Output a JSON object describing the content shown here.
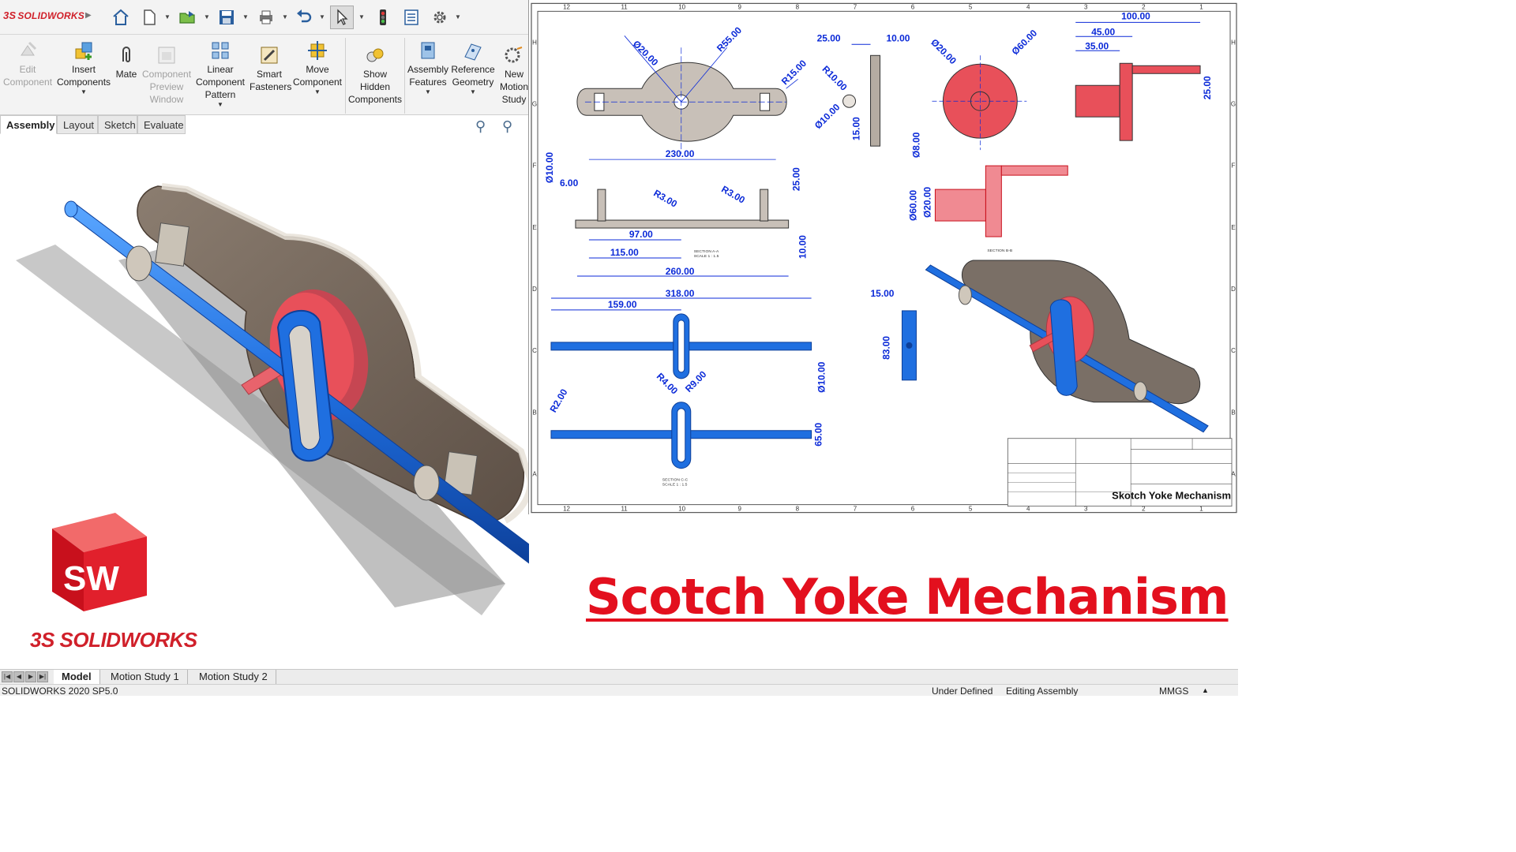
{
  "app": {
    "brand": "SOLIDWORKS",
    "brand_prefix": "3S"
  },
  "ribbon": {
    "buttons": [
      {
        "label": "Edit Component",
        "lines": [
          "Edit",
          "Component"
        ],
        "enabled": false
      },
      {
        "label": "Insert Components",
        "lines": [
          "Insert",
          "Components"
        ],
        "enabled": true,
        "dropdown": true
      },
      {
        "label": "Mate",
        "lines": [
          "Mate"
        ],
        "enabled": true
      },
      {
        "label": "Component Preview Window",
        "lines": [
          "Component",
          "Preview",
          "Window"
        ],
        "enabled": false
      },
      {
        "label": "Linear Component Pattern",
        "lines": [
          "Linear",
          "Component",
          "Pattern"
        ],
        "enabled": true,
        "dropdown": true
      },
      {
        "label": "Smart Fasteners",
        "lines": [
          "Smart",
          "Fasteners"
        ],
        "enabled": true
      },
      {
        "label": "Move Component",
        "lines": [
          "Move",
          "Component"
        ],
        "enabled": true,
        "dropdown": true
      },
      {
        "label": "Show Hidden Components",
        "lines": [
          "Show",
          "Hidden",
          "Components"
        ],
        "enabled": true
      },
      {
        "label": "Assembly Features",
        "lines": [
          "Assembly",
          "Features"
        ],
        "enabled": true,
        "dropdown": true
      },
      {
        "label": "Reference Geometry",
        "lines": [
          "Reference",
          "Geometry"
        ],
        "enabled": true,
        "dropdown": true
      },
      {
        "label": "New Motion Study",
        "lines": [
          "New",
          "Motion",
          "Study"
        ],
        "enabled": true
      }
    ]
  },
  "command_tabs": [
    "Assembly",
    "Layout",
    "Sketch",
    "Evaluate"
  ],
  "active_command_tab": "Assembly",
  "bottom_tabs": [
    "Model",
    "Motion Study 1",
    "Motion Study 2"
  ],
  "active_bottom_tab": "Model",
  "status_bar": {
    "version": "SOLIDWORKS 2020 SP5.0",
    "state": "Under Defined",
    "mode": "Editing Assembly",
    "units": "MMGS"
  },
  "title_overlay": "Scotch Yoke Mechanism",
  "logo_caption": "SOLIDWORKS",
  "logo_letters": "SW",
  "drawing": {
    "title_block_name": "Skotch Yoke Mechanism",
    "zone_columns": [
      "12",
      "11",
      "10",
      "9",
      "8",
      "7",
      "6",
      "5",
      "4",
      "3",
      "2",
      "1"
    ],
    "zone_rows": [
      "H",
      "G",
      "F",
      "E",
      "D",
      "C",
      "B",
      "A"
    ],
    "dimensions": {
      "base_top": [
        "Ø20.00",
        "R55.00",
        "R15.00",
        "230.00"
      ],
      "base_side": [
        "25.00",
        "10.00",
        "R10.00",
        "Ø10.00",
        "15.00"
      ],
      "disc_front": [
        "Ø20.00",
        "Ø60.00"
      ],
      "disc_side": [
        "100.00",
        "45.00",
        "35.00",
        "25.00"
      ],
      "section_aa": [
        "Ø10.00",
        "6.00",
        "R3.00",
        "R3.00",
        "25.00",
        "97.00",
        "115.00",
        "260.00",
        "10.00"
      ],
      "section_bb": [
        "Ø8.00",
        "Ø60.00",
        "Ø20.00"
      ],
      "yoke_front": [
        "318.00",
        "159.00",
        "R4.00",
        "R9.00",
        "Ø10.00"
      ],
      "yoke_section": [
        "R2.00",
        "65.00"
      ],
      "yoke_side": [
        "15.00",
        "83.00"
      ]
    },
    "notes": {
      "section_aa": "SECTION A-A",
      "section_aa_scale": "SCALE 1 : 1.5",
      "section_bb": "SECTION B-B",
      "section_cc": "SECTION C-C",
      "section_cc_scale": "SCALE 1 : 1.5"
    }
  },
  "colors": {
    "brand_red": "#d0202a",
    "title_red": "#e3101e",
    "dimension_blue": "#0b2ad8",
    "rod_blue": "#1f6fe0",
    "pin_red": "#e8505a",
    "base_brown": "#786a5e"
  }
}
